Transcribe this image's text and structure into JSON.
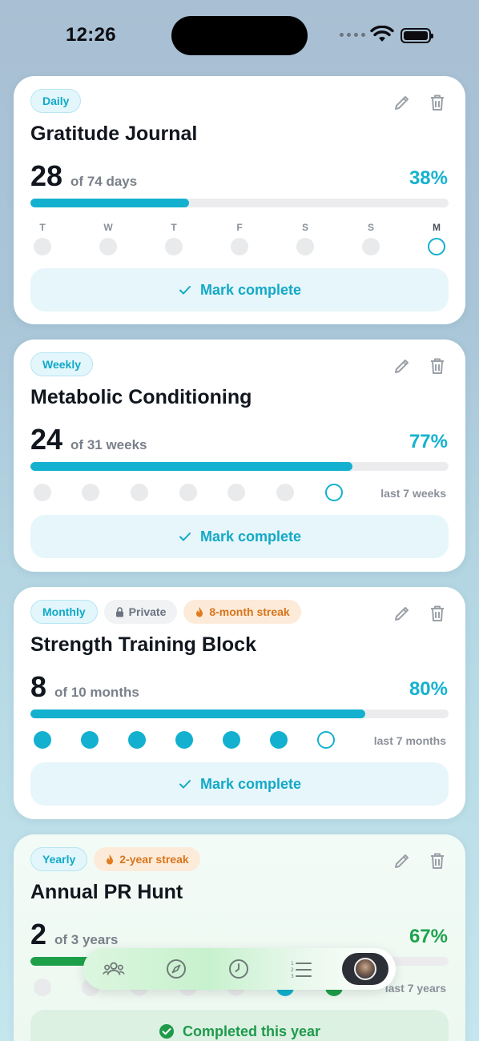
{
  "status": {
    "time": "12:26"
  },
  "cards": [
    {
      "freq": "Daily",
      "title": "Gratitude Journal",
      "count": "28",
      "of": "of 74 days",
      "percent_label": "38%",
      "progress": 0.38,
      "days": [
        "T",
        "W",
        "T",
        "F",
        "S",
        "S",
        "M"
      ],
      "action": "Mark complete"
    },
    {
      "freq": "Weekly",
      "title": "Metabolic Conditioning",
      "count": "24",
      "of": "of 31 weeks",
      "percent_label": "77%",
      "progress": 0.77,
      "note": "last 7 weeks",
      "action": "Mark complete"
    },
    {
      "freq": "Monthly",
      "private": "Private",
      "streak": "8-month streak",
      "title": "Strength Training Block",
      "count": "8",
      "of": "of 10 months",
      "percent_label": "80%",
      "progress": 0.8,
      "note": "last 7 months",
      "action": "Mark complete"
    },
    {
      "freq": "Yearly",
      "streak": "2-year streak",
      "title": "Annual PR Hunt",
      "count": "2",
      "of": "of 3 years",
      "percent_label": "67%",
      "progress": 0.67,
      "note": "last 7 years",
      "action": "Completed this year"
    }
  ],
  "tabbar": {
    "items": [
      "people-icon",
      "compass-icon",
      "clock-icon",
      "list-icon",
      "avatar"
    ]
  },
  "colors": {
    "accent": "#13b1cf",
    "success": "#1ea04b",
    "streak": "#d8751c"
  }
}
